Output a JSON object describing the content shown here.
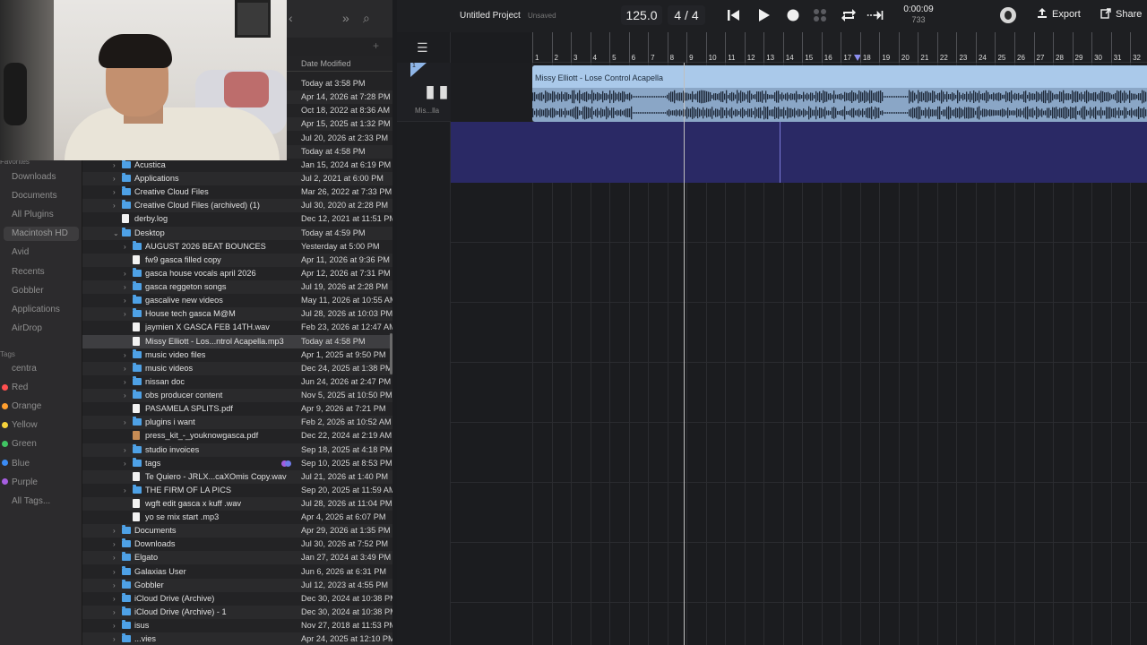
{
  "finder": {
    "toolbar": {
      "chevrons": "»",
      "search": "⌕",
      "back": "‹"
    },
    "column_header": "Date Modified",
    "add": "+",
    "sidebar": {
      "favorites_heading": "Favorites",
      "favorites": [
        "Downloads",
        "Documents",
        "All Plugins",
        "Macintosh HD",
        "Avid",
        "Recents",
        "Gobbler",
        "Applications",
        "AirDrop"
      ],
      "active_item": "Macintosh HD",
      "tags_heading": "Tags",
      "tags": [
        {
          "label": "centra",
          "color": "transparent"
        },
        {
          "label": "Red",
          "color": "#ff4f4f"
        },
        {
          "label": "Orange",
          "color": "#ff9f2e"
        },
        {
          "label": "Yellow",
          "color": "#f5d23b"
        },
        {
          "label": "Green",
          "color": "#40c463"
        },
        {
          "label": "Blue",
          "color": "#3b8cf5"
        },
        {
          "label": "Purple",
          "color": "#a65ee0"
        },
        {
          "label": "All Tags...",
          "color": "transparent"
        }
      ]
    },
    "top_dates": [
      "Today at 3:58 PM",
      "Apr 14, 2026 at 7:28 PM",
      "Oct 18, 2022 at 8:36 AM",
      "Apr 15, 2025 at 1:32 PM",
      "Jul 20, 2026 at 2:33 PM",
      "Today at 4:58 PM"
    ],
    "rows": [
      {
        "name": "Acustica",
        "date": "Jan 15, 2024 at 6:19 PM",
        "kind": "folder",
        "level": 0,
        "chevron": "›"
      },
      {
        "name": "Applications",
        "date": "Jul 2, 2021 at 6:00 PM",
        "kind": "folder",
        "level": 0,
        "chevron": "›"
      },
      {
        "name": "Creative Cloud Files",
        "date": "Mar 26, 2022 at 7:33 PM",
        "kind": "folder",
        "level": 0,
        "chevron": "›"
      },
      {
        "name": "Creative Cloud Files (archived) (1)",
        "date": "Jul 30, 2020 at 2:28 PM",
        "kind": "folder",
        "level": 0,
        "chevron": "›"
      },
      {
        "name": "derby.log",
        "date": "Dec 12, 2021 at 11:51 PM",
        "kind": "doc",
        "level": 0,
        "chevron": ""
      },
      {
        "name": "Desktop",
        "date": "Today at 4:59 PM",
        "kind": "folder",
        "level": 0,
        "chevron": "⌄"
      },
      {
        "name": "AUGUST 2026 BEAT BOUNCES",
        "date": "Yesterday at 5:00 PM",
        "kind": "folder",
        "level": 1,
        "chevron": "›"
      },
      {
        "name": "fw9 gasca filled copy",
        "date": "Apr 11, 2026 at 9:36 PM",
        "kind": "doc",
        "level": 1,
        "chevron": ""
      },
      {
        "name": "gasca house vocals april 2026",
        "date": "Apr 12, 2026 at 7:31 PM",
        "kind": "folder",
        "level": 1,
        "chevron": "›"
      },
      {
        "name": "gasca reggeton songs",
        "date": "Jul 19, 2026 at 2:28 PM",
        "kind": "folder",
        "level": 1,
        "chevron": "›"
      },
      {
        "name": "gascalive new videos",
        "date": "May 11, 2026 at 10:55 AM",
        "kind": "folder",
        "level": 1,
        "chevron": "›"
      },
      {
        "name": "House tech gasca M@M",
        "date": "Jul 28, 2026 at 10:03 PM",
        "kind": "folder",
        "level": 1,
        "chevron": "›"
      },
      {
        "name": "jaymien X GASCA FEB 14TH.wav",
        "date": "Feb 23, 2026 at 12:47 AM",
        "kind": "doc",
        "level": 1,
        "chevron": ""
      },
      {
        "name": "Missy Elliott - Los...ntrol Acapella.mp3",
        "date": "Today at 4:58 PM",
        "kind": "doc",
        "level": 1,
        "chevron": "",
        "selected": true
      },
      {
        "name": "music video files",
        "date": "Apr 1, 2025 at 9:50 PM",
        "kind": "folder",
        "level": 1,
        "chevron": "›"
      },
      {
        "name": "music videos",
        "date": "Dec 24, 2025 at 1:38 PM",
        "kind": "folder",
        "level": 1,
        "chevron": "›"
      },
      {
        "name": "nissan doc",
        "date": "Jun 24, 2026 at 2:47 PM",
        "kind": "folder",
        "level": 1,
        "chevron": "›"
      },
      {
        "name": "obs producer content",
        "date": "Nov 5, 2025 at 10:50 PM",
        "kind": "folder",
        "level": 1,
        "chevron": "›"
      },
      {
        "name": "PASAMELA SPLITS.pdf",
        "date": "Apr 9, 2026 at 7:21 PM",
        "kind": "doc",
        "level": 1,
        "chevron": ""
      },
      {
        "name": "plugins i want",
        "date": "Feb 2, 2026 at 10:52 AM",
        "kind": "folder",
        "level": 1,
        "chevron": "›"
      },
      {
        "name": "press_kit_-_youknowgasca.pdf",
        "date": "Dec 22, 2024 at 2:19 AM",
        "kind": "img",
        "level": 1,
        "chevron": ""
      },
      {
        "name": "studio invoices",
        "date": "Sep 18, 2025 at 4:18 PM",
        "kind": "folder",
        "level": 1,
        "chevron": "›"
      },
      {
        "name": "tags",
        "date": "Sep 10, 2025 at 8:53 PM",
        "kind": "folder",
        "level": 1,
        "chevron": "›",
        "tags": true
      },
      {
        "name": "Te Quiero - JRLX...caXOmis Copy.wav",
        "date": "Jul 21, 2026 at 1:40 PM",
        "kind": "doc",
        "level": 1,
        "chevron": ""
      },
      {
        "name": "THE FIRM OF LA PICS",
        "date": "Sep 20, 2025 at 11:59 AM",
        "kind": "folder",
        "level": 1,
        "chevron": "›"
      },
      {
        "name": "wgft edit gasca x kuff .wav",
        "date": "Jul 28, 2026 at 11:04 PM",
        "kind": "doc",
        "level": 1,
        "chevron": ""
      },
      {
        "name": "yo se mix start .mp3",
        "date": "Apr 4, 2026 at 6:07 PM",
        "kind": "doc",
        "level": 1,
        "chevron": ""
      },
      {
        "name": "Documents",
        "date": "Apr 29, 2026 at 1:35 PM",
        "kind": "folder",
        "level": 0,
        "chevron": "›"
      },
      {
        "name": "Downloads",
        "date": "Jul 30, 2026 at 7:52 PM",
        "kind": "folder",
        "level": 0,
        "chevron": "›"
      },
      {
        "name": "Elgato",
        "date": "Jan 27, 2024 at 3:49 PM",
        "kind": "folder",
        "level": 0,
        "chevron": "›"
      },
      {
        "name": "Galaxias User",
        "date": "Jun 6, 2026 at 6:31 PM",
        "kind": "folder",
        "level": 0,
        "chevron": "›"
      },
      {
        "name": "Gobbler",
        "date": "Jul 12, 2023 at 4:55 PM",
        "kind": "folder",
        "level": 0,
        "chevron": "›"
      },
      {
        "name": "iCloud Drive (Archive)",
        "date": "Dec 30, 2024 at 10:38 PM",
        "kind": "folder",
        "level": 0,
        "chevron": "›"
      },
      {
        "name": "iCloud Drive (Archive) - 1",
        "date": "Dec 30, 2024 at 10:38 PM",
        "kind": "folder",
        "level": 0,
        "chevron": "›"
      },
      {
        "name": "isus",
        "date": "Nov 27, 2018 at 11:53 PM",
        "kind": "folder",
        "level": 0,
        "chevron": "›"
      },
      {
        "name": "...vies",
        "date": "Apr 24, 2025 at 12:10 PM",
        "kind": "folder",
        "level": 0,
        "chevron": "›"
      }
    ]
  },
  "daw": {
    "project_name": "Untitled Project",
    "project_status": "Unsaved",
    "tempo": "125.0",
    "time_signature": "4 / 4",
    "time_display": "0:00:09",
    "time_sub": "733",
    "export_label": "Export",
    "share_label": "Share",
    "menu_icon": "☰",
    "track": {
      "number": "1",
      "label": "Mis...lla",
      "icon": "▐▌▐▌"
    },
    "bars": [
      "1",
      "2",
      "3",
      "4",
      "5",
      "6",
      "7",
      "8",
      "9",
      "10",
      "11",
      "12",
      "13",
      "14",
      "15",
      "16",
      "17",
      "18",
      "19",
      "20",
      "21",
      "22",
      "23",
      "24",
      "25",
      "26",
      "27",
      "28",
      "29",
      "30",
      "31",
      "32"
    ],
    "clip": {
      "title": "Missy Elliott - Lose Control Acapella",
      "color": "#aac9ea"
    },
    "colors": {
      "accent": "#8d8ff0",
      "lane": "#2a2965",
      "background": "#1b1c1f"
    }
  }
}
